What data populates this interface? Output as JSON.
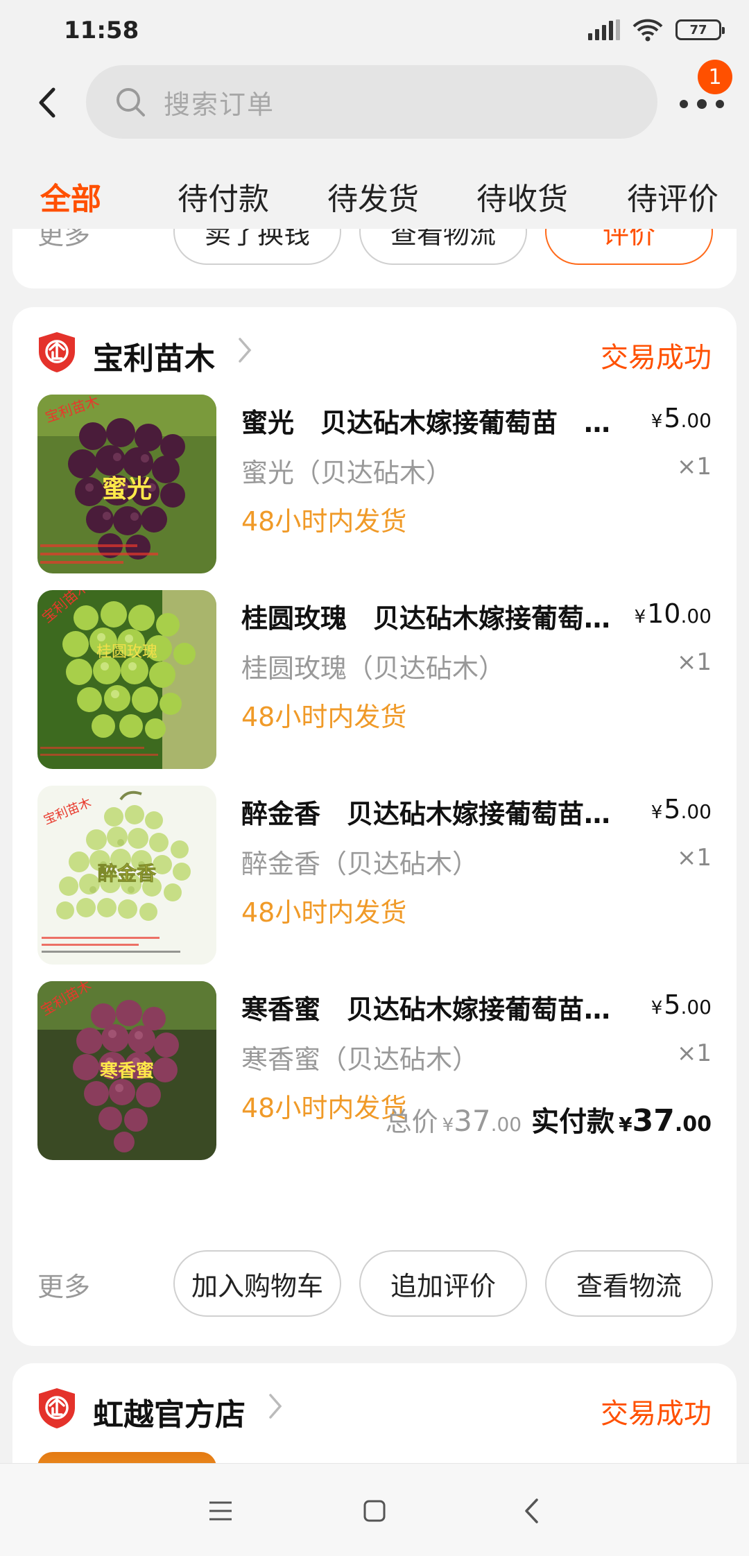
{
  "status_bar": {
    "time": "11:58",
    "battery": "77"
  },
  "search": {
    "placeholder": "搜索订单",
    "badge_count": "1"
  },
  "tabs": [
    {
      "label": "全部",
      "active": true
    },
    {
      "label": "待付款",
      "active": false
    },
    {
      "label": "待发货",
      "active": false
    },
    {
      "label": "待收货",
      "active": false
    },
    {
      "label": "待评价",
      "active": false
    }
  ],
  "prev_order": {
    "more_label": "更多",
    "buttons": [
      "卖了换钱",
      "查看物流",
      "评价"
    ]
  },
  "order": {
    "shop_name": "宝利苗木",
    "status": "交易成功",
    "items": [
      {
        "title": "蜜光　贝达砧木嫁接葡萄苗　…",
        "sku": "蜜光（贝达砧木）",
        "qty": "×1",
        "shipping": "48小时内发货",
        "price_yen": "¥",
        "price_int": "5",
        "price_cents": ".00",
        "thumb_text": "蜜光",
        "thumb_tag": "宝利苗木"
      },
      {
        "title": "桂圆玫瑰　贝达砧木嫁接葡萄…",
        "sku": "桂圆玫瑰（贝达砧木）",
        "qty": "×1",
        "shipping": "48小时内发货",
        "price_yen": "¥",
        "price_int": "10",
        "price_cents": ".00",
        "thumb_text": "桂圆玫瑰",
        "thumb_tag": "宝利苗木"
      },
      {
        "title": "醉金香　贝达砧木嫁接葡萄苗…",
        "sku": "醉金香（贝达砧木）",
        "qty": "×1",
        "shipping": "48小时内发货",
        "price_yen": "¥",
        "price_int": "5",
        "price_cents": ".00",
        "thumb_text": "醉金香",
        "thumb_tag": "宝利苗木"
      },
      {
        "title": "寒香蜜　贝达砧木嫁接葡萄苗…",
        "sku": "寒香蜜（贝达砧木）",
        "qty": "×1",
        "shipping": "48小时内发货",
        "price_yen": "¥",
        "price_int": "5",
        "price_cents": ".00",
        "thumb_text": "寒香蜜",
        "thumb_tag": "宝利苗木"
      }
    ],
    "total_label": "总价",
    "total_yen": "¥",
    "total_int": "37",
    "total_cents": ".00",
    "paid_label": "实付款",
    "paid_yen": "¥",
    "paid_int": "37",
    "paid_cents": ".00",
    "more_label": "更多",
    "buttons": [
      "加入购物车",
      "追加评价",
      "查看物流"
    ]
  },
  "next_order": {
    "shop_name": "虹越官方店",
    "status": "交易成功"
  },
  "colors": {
    "accent": "#ff5000",
    "shipping": "#f09a28",
    "muted": "#999999",
    "background": "#f2f2f2",
    "grape_purple": "#5a1e3c",
    "grape_green": "#a8cf4a",
    "grape_pale": "#c7de86",
    "grape_red": "#8a3d5c"
  },
  "icons": [
    "back-arrow-icon",
    "search-icon",
    "more-dots-icon",
    "enterprise-shield-icon",
    "chevron-right-icon",
    "menu-icon",
    "home-square-icon",
    "nav-back-icon"
  ]
}
